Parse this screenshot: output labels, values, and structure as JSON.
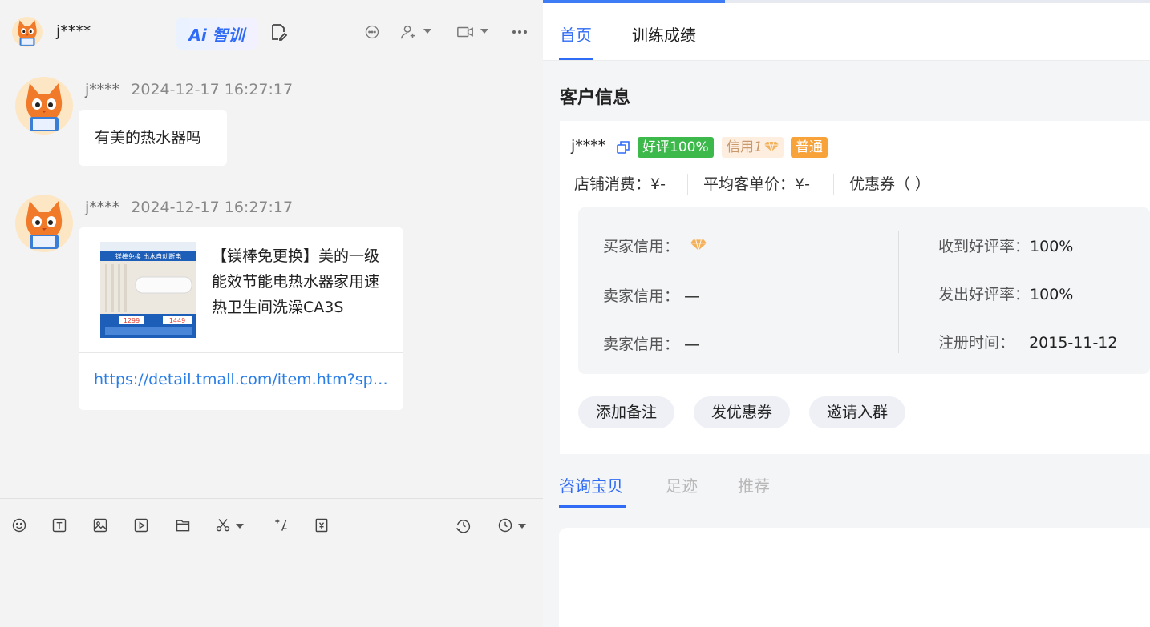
{
  "chat": {
    "header": {
      "contact_name": "j****",
      "ai_badge": "Ai 智训"
    },
    "messages": [
      {
        "sender": "j****",
        "time": "2024-12-17 16:27:17",
        "text": "有美的热水器吗"
      },
      {
        "sender": "j****",
        "time": "2024-12-17 16:27:17",
        "product": {
          "image_caption_top": "镁棒免换 出水自动断电",
          "image_price_1": "1299",
          "image_price_2": "1449",
          "title": "【镁棒免更换】美的一级能效节能电热水器家用速热卫生间洗澡CA3S",
          "link": "https://detail.tmall.com/item.htm?spm..."
        }
      }
    ],
    "toolbar": {
      "icons": [
        "emoji-icon",
        "text-format-icon",
        "image-icon",
        "video-icon",
        "folder-icon",
        "scissors-icon",
        "calculator-icon",
        "yuan-receipt-icon",
        "history-icon",
        "clock-icon"
      ]
    }
  },
  "panel": {
    "progress": 0.3,
    "tabs": [
      "首页",
      "训练成绩"
    ],
    "section_title": "客户信息",
    "customer": {
      "name": "j****",
      "tag_good_rate": "好评100%",
      "tag_credit_label": "信用",
      "tag_credit_num": "1",
      "tag_level": "普通",
      "stats": {
        "shop_spend": "店铺消费：¥-",
        "avg_order": "平均客单价：¥-",
        "coupons": "优惠券（ ）"
      },
      "info_left": [
        {
          "label": "买家信用：",
          "value": ""
        },
        {
          "label": "卖家信用：",
          "value": "—"
        },
        {
          "label": "卖家信用：",
          "value": "—"
        }
      ],
      "info_right": [
        {
          "label": "收到好评率：",
          "value": "100%"
        },
        {
          "label": "发出好评率：",
          "value": "100%"
        },
        {
          "label": "注册时间：",
          "value": "2015-11-12"
        }
      ],
      "actions": [
        "添加备注",
        "发优惠券",
        "邀请入群"
      ]
    },
    "sub_tabs": [
      "咨询宝贝",
      "足迹",
      "推荐"
    ],
    "colors": {
      "accent": "#2f6bf5",
      "good_tag": "#3cb94a",
      "level_tag": "#f8a23a",
      "link": "#2a7ee6"
    }
  }
}
